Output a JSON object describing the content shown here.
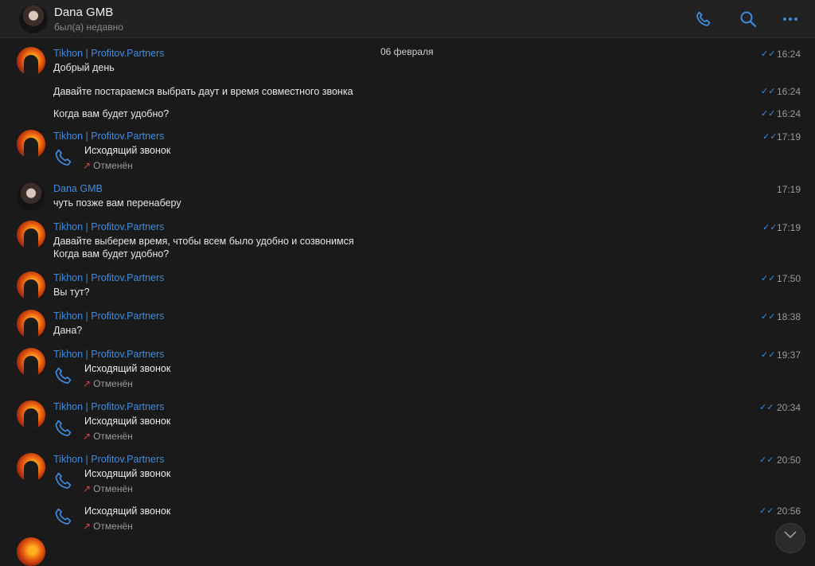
{
  "header": {
    "name": "Dana GMB",
    "status": "был(а) недавно"
  },
  "chat": {
    "date": "06 февраля"
  },
  "messages": [
    {
      "sender": "Tikhon | Profitov.Partners",
      "text": "Добрый день",
      "time": "16:24"
    },
    {
      "text": "Давайте постараемся выбрать даут и время совместного звонка",
      "time": "16:24"
    },
    {
      "text": "Когда вам будет удобно?",
      "time": "16:24"
    },
    {
      "sender": "Tikhon | Profitov.Partners",
      "call_title": "Исходящий звонок",
      "call_status": "Отменён",
      "time": "17:19"
    },
    {
      "sender": "Dana GMB",
      "text": "чуть позже вам перенаберу",
      "time": "17:19"
    },
    {
      "sender": "Tikhon | Profitov.Partners",
      "text": "Давайте выберем время, чтобы всем было удобно и созвонимся",
      "text2": "Когда вам будет удобно?",
      "time": "17:19"
    },
    {
      "sender": "Tikhon | Profitov.Partners",
      "text": "Вы тут?",
      "time": "17:50"
    },
    {
      "sender": "Tikhon | Profitov.Partners",
      "text": "Дана?",
      "time": "18:38"
    },
    {
      "sender": "Tikhon | Profitov.Partners",
      "call_title": "Исходящий звонок",
      "call_status": "Отменён",
      "time": "19:37"
    },
    {
      "sender": "Tikhon | Profitov.Partners",
      "call_title": "Исходящий звонок",
      "call_status": "Отменён",
      "time": "20:34"
    },
    {
      "sender": "Tikhon | Profitov.Partners",
      "call_title": "Исходящий звонок",
      "call_status": "Отменён",
      "time": "20:50"
    },
    {
      "call_title": "Исходящий звонок",
      "call_status": "Отменён",
      "time": "20:56"
    }
  ],
  "icons": {
    "call": "phone-icon",
    "search": "search-icon",
    "more": "more-icon",
    "read": "double-check-icon",
    "scroll": "chevron-down-icon"
  },
  "colors": {
    "accent": "#3d8ce0",
    "cancelled": "#e0443a",
    "background": "#1a1a1a"
  }
}
